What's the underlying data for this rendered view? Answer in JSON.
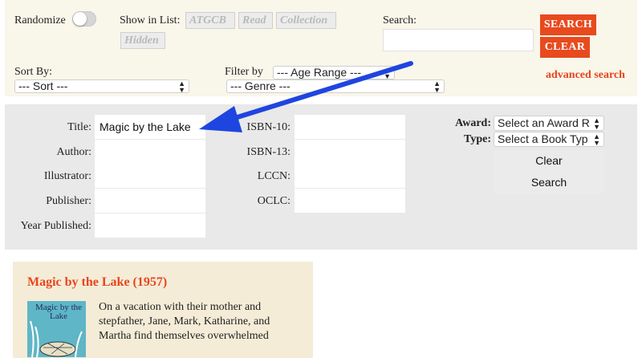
{
  "top_bar": {
    "randomize_label": "Randomize",
    "show_in_list_label": "Show in List:",
    "filters": [
      "ATGCB",
      "Read",
      "Collection",
      "Hidden"
    ],
    "search_label": "Search:",
    "search_value": "",
    "search_button": "SEARCH",
    "clear_button": "CLEAR",
    "advanced_search": "advanced search",
    "sort_by_label": "Sort By:",
    "sort_value": "--- Sort ---",
    "filter_by_label": "Filter by",
    "age_range_value": "--- Age Range ---",
    "genre_value": "--- Genre ---"
  },
  "advanced_form": {
    "title_label": "Title:",
    "title_value": "Magic by the Lake",
    "author_label": "Author:",
    "illustrator_label": "Illustrator:",
    "publisher_label": "Publisher:",
    "year_published_label": "Year Published:",
    "isbn10_label": "ISBN-10:",
    "isbn13_label": "ISBN-13:",
    "lccn_label": "LCCN:",
    "oclc_label": "OCLC:",
    "award_label": "Award:",
    "award_value": "Select an Award R",
    "type_label": "Type:",
    "type_value": "Select a Book Typ",
    "clear_label": "Clear",
    "search_label": "Search"
  },
  "result": {
    "title": "Magic by the Lake (1957)",
    "cover_title": "Magic by the Lake",
    "description": "On a vacation with their mother and stepfather, Jane, Mark, Katharine, and Martha find themselves overwhelmed"
  },
  "colors": {
    "accent": "#e8451d",
    "button_red": "#e84a1e",
    "top_bg": "#f9f6ea",
    "form_bg": "#e9e9e9",
    "card_bg": "#f4ecd7",
    "arrow": "#1f45e0"
  },
  "icons": {
    "toggle": "toggle-switch-icon",
    "select": "updown-arrows-icon",
    "annotation": "blue-arrow-icon"
  }
}
